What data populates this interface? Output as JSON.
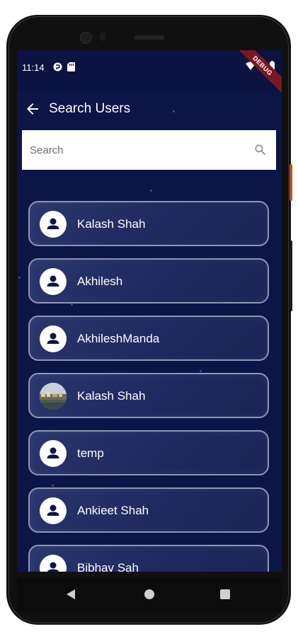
{
  "status_bar": {
    "time": "11:14"
  },
  "debug_banner": "DEBUG",
  "app_bar": {
    "title": "Search Users"
  },
  "search": {
    "placeholder": "Search",
    "value": ""
  },
  "users": [
    {
      "name": "Kalash Shah",
      "avatar": "person-icon"
    },
    {
      "name": "Akhilesh",
      "avatar": "person-icon"
    },
    {
      "name": "AkhileshManda",
      "avatar": "person-icon"
    },
    {
      "name": "Kalash Shah",
      "avatar": "photo"
    },
    {
      "name": "temp",
      "avatar": "person-icon"
    },
    {
      "name": "Ankieet Shah",
      "avatar": "person-icon"
    },
    {
      "name": "Bibhav Sah",
      "avatar": "person-icon"
    }
  ],
  "colors": {
    "background": "#0b1546",
    "card": "#1e2a60",
    "card_border": "#8f95b6",
    "debug": "#7a1720"
  }
}
